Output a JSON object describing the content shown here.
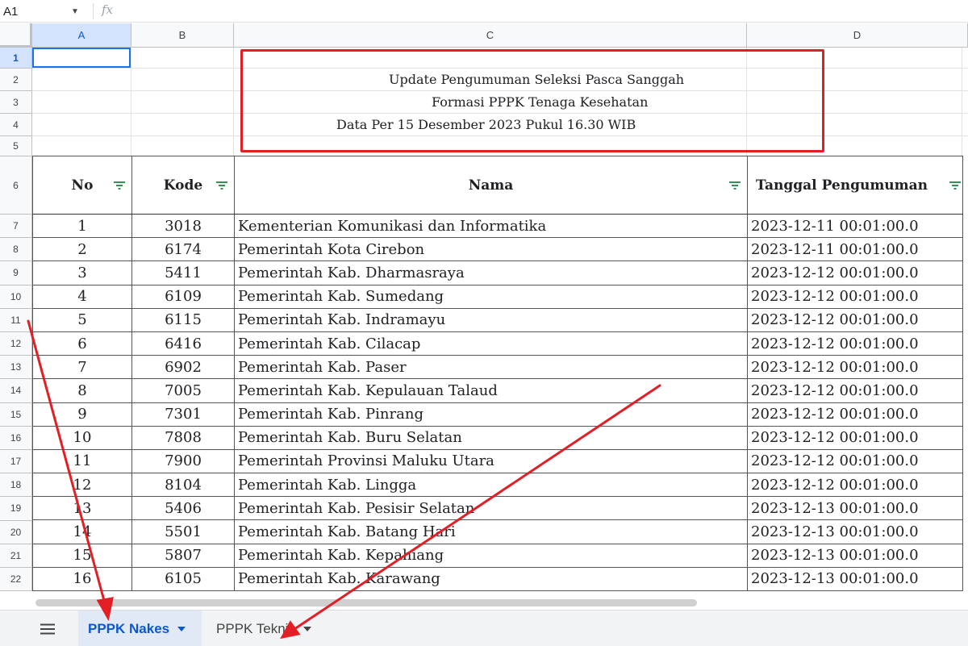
{
  "formula_bar": {
    "cell_ref": "A1",
    "fx_label": "fx"
  },
  "columns": [
    "A",
    "B",
    "C",
    "D"
  ],
  "rows": [
    "1",
    "2",
    "3",
    "4",
    "5",
    "6",
    "7",
    "8",
    "9",
    "10",
    "11",
    "12",
    "13",
    "14",
    "15",
    "16",
    "17",
    "18",
    "19",
    "20",
    "21",
    "22"
  ],
  "title": {
    "line1": "Update Pengumuman Seleksi Pasca Sanggah",
    "line2": "Formasi PPPK Tenaga Kesehatan",
    "line3": "Data Per 15 Desember 2023 Pukul 16.30 WIB"
  },
  "table": {
    "headers": [
      "No",
      "Kode",
      "Nama",
      "Tanggal Pengumuman"
    ],
    "rows": [
      [
        "1",
        "3018",
        "Kementerian Komunikasi dan Informatika",
        "2023-12-11 00:01:00.0"
      ],
      [
        "2",
        "6174",
        "Pemerintah Kota Cirebon",
        "2023-12-11 00:01:00.0"
      ],
      [
        "3",
        "5411",
        "Pemerintah Kab. Dharmasraya",
        "2023-12-12 00:01:00.0"
      ],
      [
        "4",
        "6109",
        "Pemerintah Kab. Sumedang",
        "2023-12-12 00:01:00.0"
      ],
      [
        "5",
        "6115",
        "Pemerintah Kab. Indramayu",
        "2023-12-12 00:01:00.0"
      ],
      [
        "6",
        "6416",
        "Pemerintah Kab. Cilacap",
        "2023-12-12 00:01:00.0"
      ],
      [
        "7",
        "6902",
        "Pemerintah Kab. Paser",
        "2023-12-12 00:01:00.0"
      ],
      [
        "8",
        "7005",
        "Pemerintah Kab. Kepulauan Talaud",
        "2023-12-12 00:01:00.0"
      ],
      [
        "9",
        "7301",
        "Pemerintah Kab. Pinrang",
        "2023-12-12 00:01:00.0"
      ],
      [
        "10",
        "7808",
        "Pemerintah Kab. Buru Selatan",
        "2023-12-12 00:01:00.0"
      ],
      [
        "11",
        "7900",
        "Pemerintah Provinsi Maluku Utara",
        "2023-12-12 00:01:00.0"
      ],
      [
        "12",
        "8104",
        "Pemerintah Kab. Lingga",
        "2023-12-12 00:01:00.0"
      ],
      [
        "13",
        "5406",
        "Pemerintah Kab. Pesisir Selatan",
        "2023-12-13 00:01:00.0"
      ],
      [
        "14",
        "5501",
        "Pemerintah Kab. Batang Hari",
        "2023-12-13 00:01:00.0"
      ],
      [
        "15",
        "5807",
        "Pemerintah Kab. Kepahiang",
        "2023-12-13 00:01:00.0"
      ],
      [
        "16",
        "6105",
        "Pemerintah Kab. Karawang",
        "2023-12-13 00:01:00.0"
      ]
    ]
  },
  "sheet_tabs": [
    {
      "label": "PPPK Nakes"
    },
    {
      "label": "PPPK Teknis"
    }
  ],
  "colors": {
    "annotation": "#e31e24",
    "selection": "#1a73e8",
    "active_tab": "#0b57d0"
  }
}
